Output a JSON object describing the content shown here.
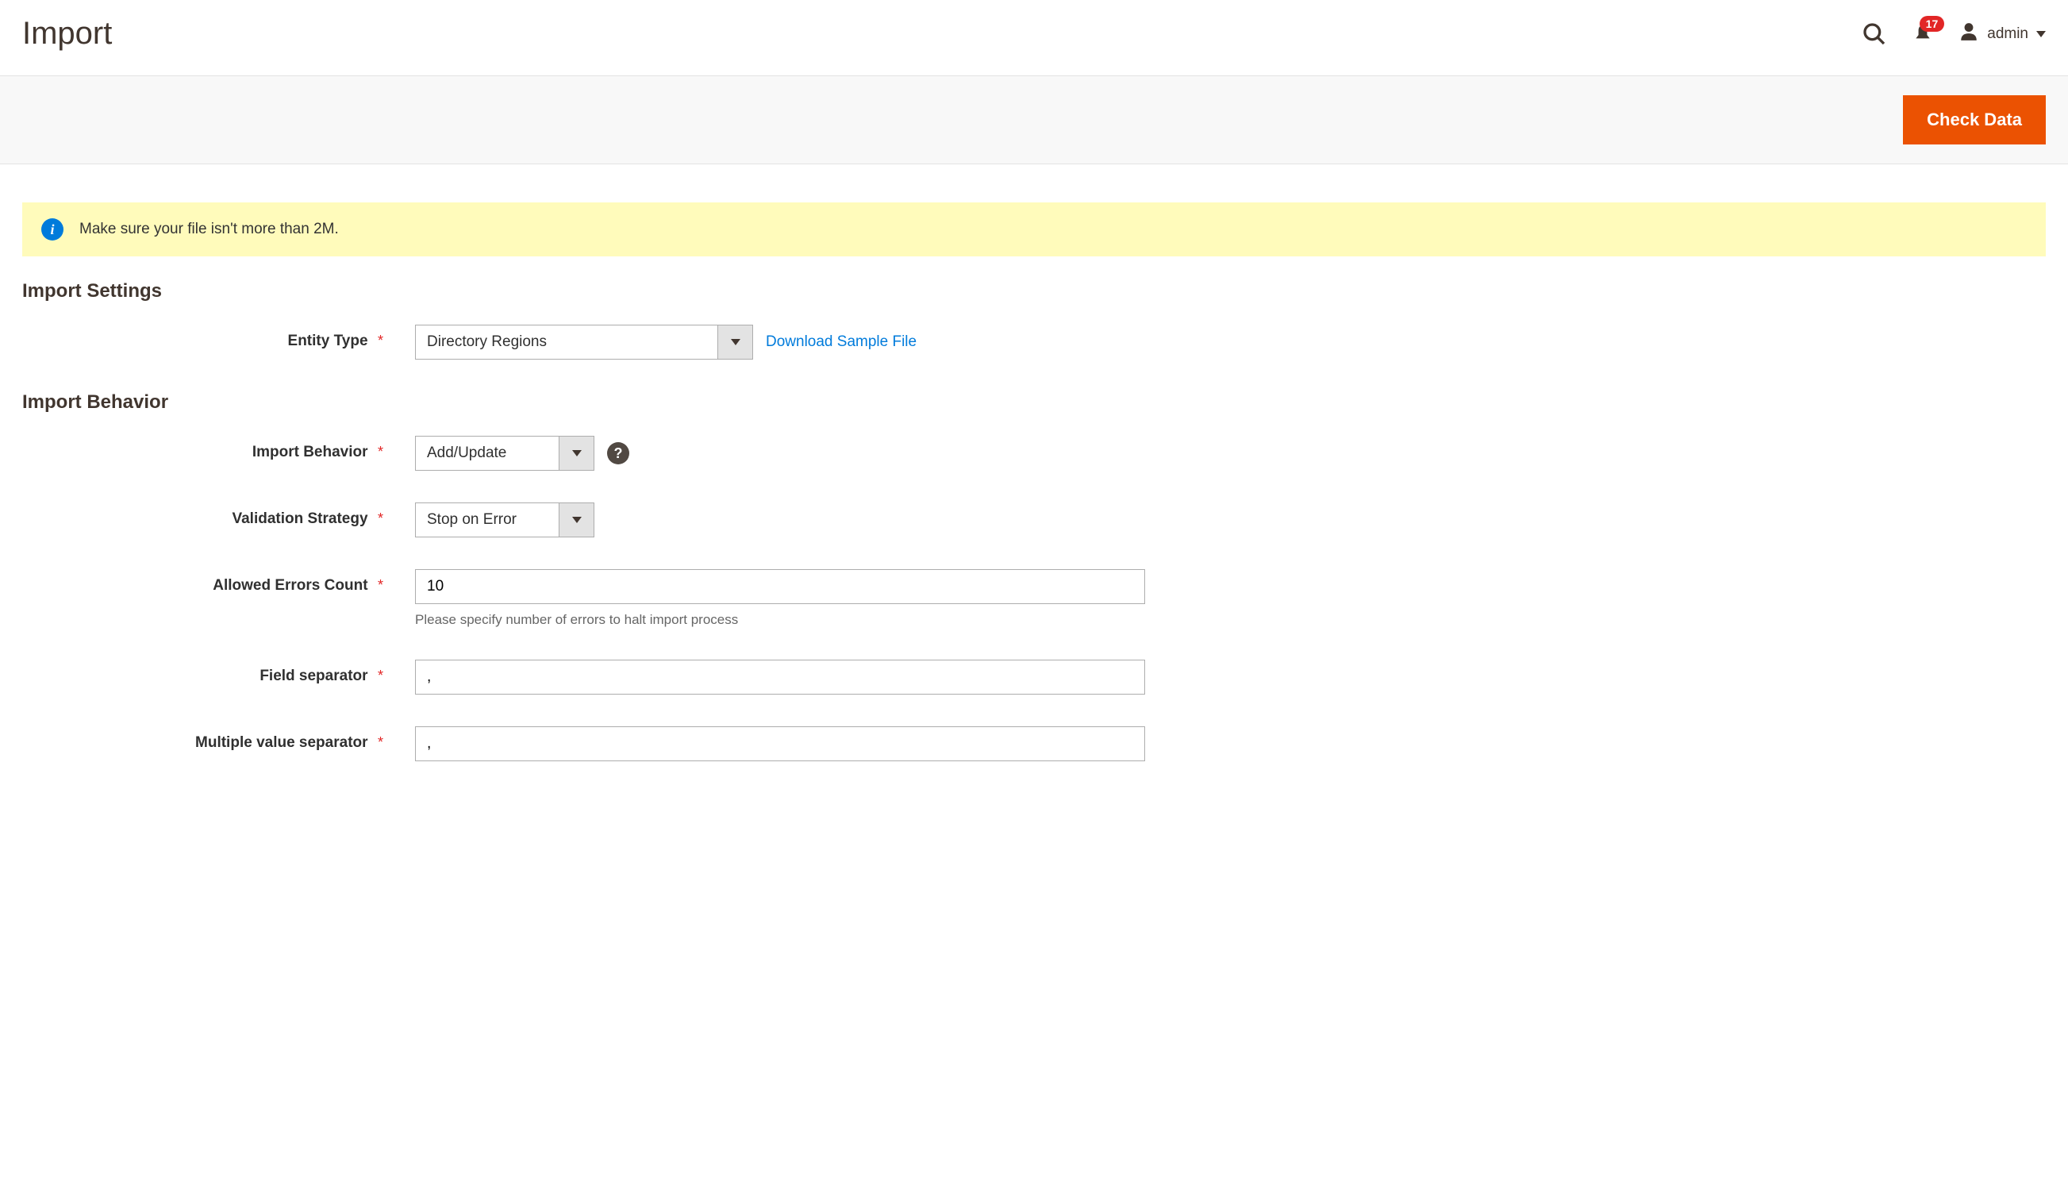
{
  "header": {
    "title": "Import",
    "notifications_count": "17",
    "user_name": "admin"
  },
  "action_bar": {
    "check_data_label": "Check Data"
  },
  "notice": {
    "text": "Make sure your file isn't more than 2M."
  },
  "sections": {
    "import_settings_title": "Import Settings",
    "import_behavior_title": "Import Behavior"
  },
  "fields": {
    "entity_type": {
      "label": "Entity Type",
      "value": "Directory Regions",
      "download_link": "Download Sample File"
    },
    "import_behavior": {
      "label": "Import Behavior",
      "value": "Add/Update"
    },
    "validation_strategy": {
      "label": "Validation Strategy",
      "value": "Stop on Error"
    },
    "allowed_errors": {
      "label": "Allowed Errors Count",
      "value": "10",
      "help": "Please specify number of errors to halt import process"
    },
    "field_separator": {
      "label": "Field separator",
      "value": ","
    },
    "multiple_value_separator": {
      "label": "Multiple value separator",
      "value": ","
    }
  }
}
